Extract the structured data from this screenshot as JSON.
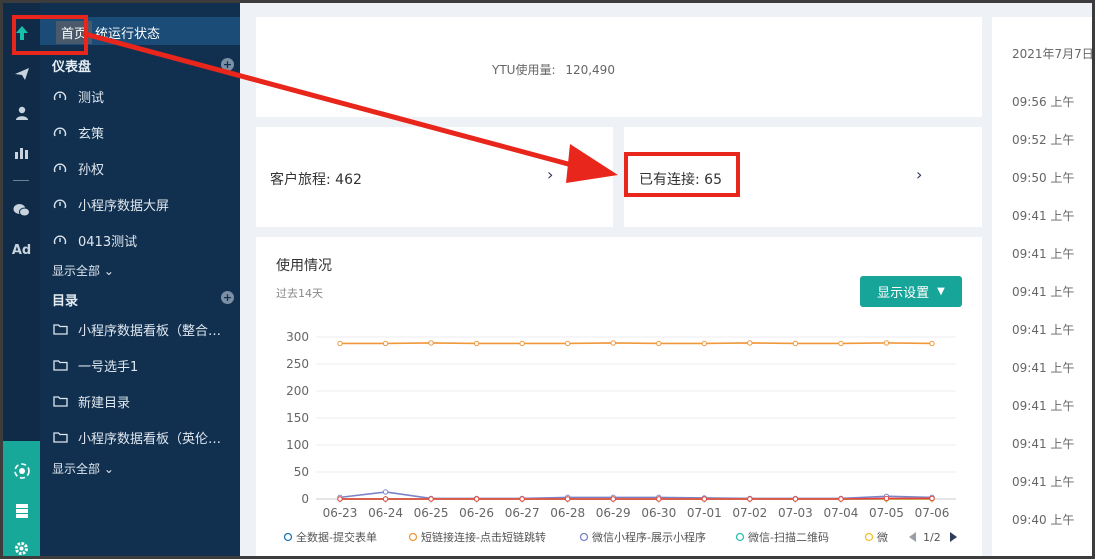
{
  "header": {
    "tooltip": "首页",
    "status_title": "统运行状态"
  },
  "rail": {
    "icons": [
      "home-icon",
      "send-icon",
      "user-icon",
      "bar-chart-icon",
      "wechat-icon",
      "ad-icon",
      "hub-icon",
      "database-icon",
      "gear-icon"
    ],
    "ad_label": "Ad"
  },
  "sidebar": {
    "dashboard_title": "仪表盘",
    "dashboard_items": [
      {
        "label": "测试",
        "icon": "gauge-icon"
      },
      {
        "label": "玄策",
        "icon": "gauge-icon"
      },
      {
        "label": "孙权",
        "icon": "gauge-icon"
      },
      {
        "label": "小程序数据大屏",
        "icon": "gauge-icon"
      },
      {
        "label": "0413测试",
        "icon": "gauge-icon"
      }
    ],
    "show_all_1": "显示全部",
    "catalog_title": "目录",
    "catalog_items": [
      {
        "label": "小程序数据看板（整合…",
        "icon": "folder-icon"
      },
      {
        "label": "一号选手1",
        "icon": "folder-icon"
      },
      {
        "label": "新建目录",
        "icon": "folder-icon"
      },
      {
        "label": "小程序数据看板（英伦…",
        "icon": "folder-icon"
      }
    ],
    "show_all_2": "显示全部"
  },
  "cards": {
    "ytu_label": "YTU使用量:",
    "ytu_value": "120,490",
    "journey": "客户旅程: 462",
    "connections": "已有连接: 65"
  },
  "usage": {
    "title": "使用情况",
    "subtitle": "过去14天",
    "settings_label": "显示设置",
    "pager": "1/2"
  },
  "chart_data": {
    "type": "line",
    "categories": [
      "06-23",
      "06-24",
      "06-25",
      "06-26",
      "06-27",
      "06-28",
      "06-29",
      "06-30",
      "07-01",
      "07-02",
      "07-03",
      "07-04",
      "07-05",
      "07-06"
    ],
    "ylim": [
      0,
      300
    ],
    "yticks": [
      0,
      50,
      100,
      150,
      200,
      250,
      300
    ],
    "grid": true,
    "legend_position": "bottom",
    "series": [
      {
        "name": "全数据-提交表单",
        "color": "#1f77b4",
        "values": [
          0,
          0,
          0,
          0,
          0,
          0,
          0,
          0,
          0,
          0,
          0,
          0,
          0,
          0
        ]
      },
      {
        "name": "短链接连接-点击短链跳转",
        "color": "#f0983c",
        "values": [
          288,
          288,
          289,
          288,
          288,
          288,
          289,
          288,
          288,
          289,
          288,
          288,
          289,
          288
        ]
      },
      {
        "name": "微信小程序-展示小程序",
        "color": "#7b84c9",
        "values": [
          3,
          13,
          1,
          1,
          1,
          3,
          3,
          3,
          2,
          1,
          1,
          1,
          5,
          3
        ]
      },
      {
        "name": "微信-扫描二维码",
        "color": "#2fc0b5",
        "values": [
          0,
          0,
          0,
          0,
          0,
          0,
          0,
          0,
          0,
          0,
          0,
          0,
          0,
          0
        ]
      },
      {
        "name": "微",
        "color": "#f2c12e",
        "values": [
          0,
          0,
          0,
          0,
          0,
          0,
          0,
          0,
          0,
          0,
          0,
          0,
          0,
          0
        ]
      },
      {
        "name": "",
        "color": "#e8413c",
        "values": [
          0,
          0,
          0,
          0,
          0,
          0,
          0,
          0,
          0,
          0,
          0,
          0,
          1,
          1
        ]
      }
    ]
  },
  "log": {
    "date": "2021年7月7日",
    "times": [
      "09:56 上午",
      "09:52 上午",
      "09:50 上午",
      "09:41 上午",
      "09:41 上午",
      "09:41 上午",
      "09:41 上午",
      "09:41 上午",
      "09:41 上午",
      "09:41 上午",
      "09:41 上午",
      "09:40 上午"
    ]
  },
  "annotation": {
    "color": "#e8261c"
  }
}
